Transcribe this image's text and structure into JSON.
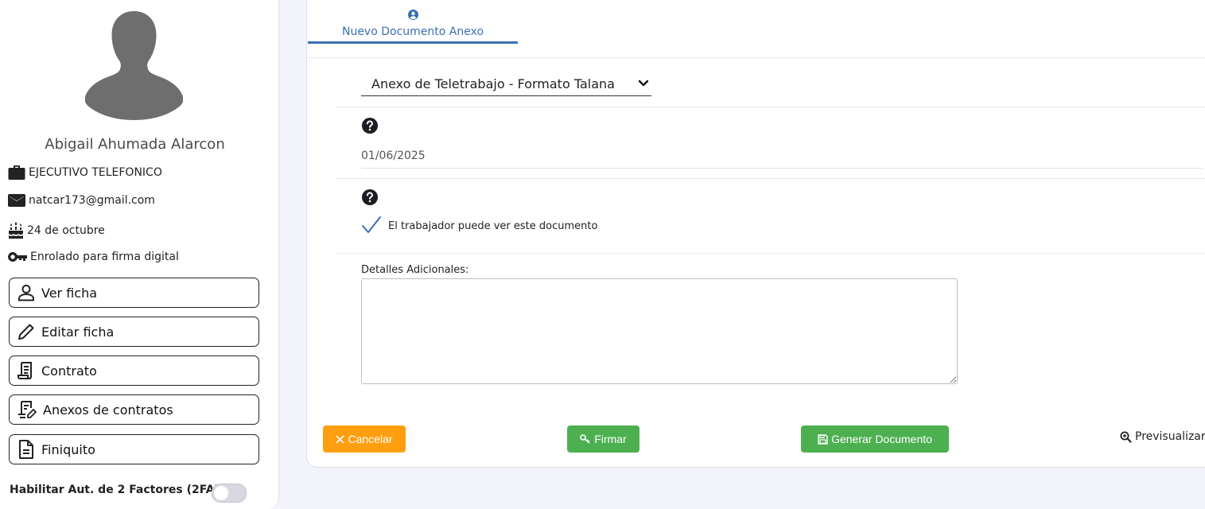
{
  "profile": {
    "name": "Abigail Ahumada Alarcon",
    "position": "EJECUTIVO TELEFONICO",
    "email": "natcar173@gmail.com",
    "birthday": "24 de octubre",
    "signature_status": "Enrolado para firma digital"
  },
  "sidebar_buttons": {
    "view_profile": "Ver ficha",
    "edit_profile": "Editar ficha",
    "contract": "Contrato",
    "annexes": "Anexos de contratos",
    "settlement": "Finiquito"
  },
  "two_factor": {
    "label": "Habilitar Aut. de 2 Factores (2FA):",
    "enabled": false
  },
  "tab": {
    "label": "Nuevo Documento Anexo"
  },
  "form": {
    "template_selected": "Anexo de Teletrabajo - Formato Talana",
    "date_value": "01/06/2025",
    "visibility_label": "El trabajador puede ver este documento",
    "visibility_checked": true,
    "details_label": "Detalles Adicionales:",
    "details_value": ""
  },
  "actions": {
    "cancel": "Cancelar",
    "sign": "Firmar",
    "generate": "Generar Documento",
    "preview": "Previsualizar"
  },
  "colors": {
    "accent": "#3b6fb0",
    "cancel": "#ff9f0f",
    "success": "#4db050"
  },
  "icons": {
    "avatar": "person-silhouette-icon",
    "position": "briefcase-icon",
    "email": "envelope-icon",
    "birthday": "cake-icon",
    "signature": "key-icon",
    "view_profile": "person-icon",
    "edit_profile": "pencil-icon",
    "contract": "scroll-icon",
    "annexes": "contract-edit-icon",
    "settlement": "document-icon",
    "tab": "user-circle-icon",
    "help": "question-circle-icon",
    "check": "checkmark-icon",
    "cancel": "close-icon",
    "sign": "key-icon",
    "generate": "save-icon",
    "preview": "zoom-in-icon"
  }
}
